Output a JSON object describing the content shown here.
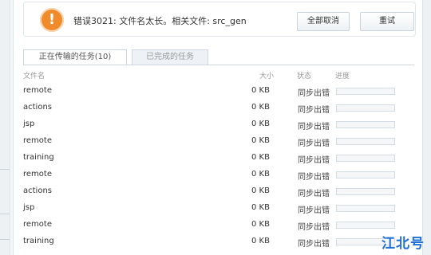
{
  "error": {
    "icon": "exclamation-icon",
    "icon_glyph": "!",
    "message": "错误3021: 文件名太长。相关文件: src_gen",
    "cancel_all_label": "全部取消",
    "retry_label": "重试"
  },
  "tabs": [
    {
      "label": "正在传输的任务(10)",
      "active": true
    },
    {
      "label": "已完成的任务",
      "active": false
    }
  ],
  "headers": {
    "name": "文件名",
    "size": "大小",
    "status": "状态",
    "progress": "进度"
  },
  "rows": [
    {
      "name": "remote",
      "size": "0 KB",
      "status": "同步出错",
      "progress": 0
    },
    {
      "name": "actions",
      "size": "0 KB",
      "status": "同步出错",
      "progress": 0
    },
    {
      "name": "jsp",
      "size": "0 KB",
      "status": "同步出错",
      "progress": 0
    },
    {
      "name": "remote",
      "size": "0 KB",
      "status": "同步出错",
      "progress": 0
    },
    {
      "name": "training",
      "size": "0 KB",
      "status": "同步出错",
      "progress": 0
    },
    {
      "name": "remote",
      "size": "0 KB",
      "status": "同步出错",
      "progress": 0
    },
    {
      "name": "actions",
      "size": "0 KB",
      "status": "同步出错",
      "progress": 0
    },
    {
      "name": "jsp",
      "size": "0 KB",
      "status": "同步出错",
      "progress": 0
    },
    {
      "name": "remote",
      "size": "0 KB",
      "status": "同步出错",
      "progress": 0
    },
    {
      "name": "training",
      "size": "0 KB",
      "status": "同步出错",
      "progress": 0
    }
  ],
  "watermark": "江北号",
  "colors": {
    "accent": "#1d6fd8",
    "warning": "#ef8b2a"
  }
}
